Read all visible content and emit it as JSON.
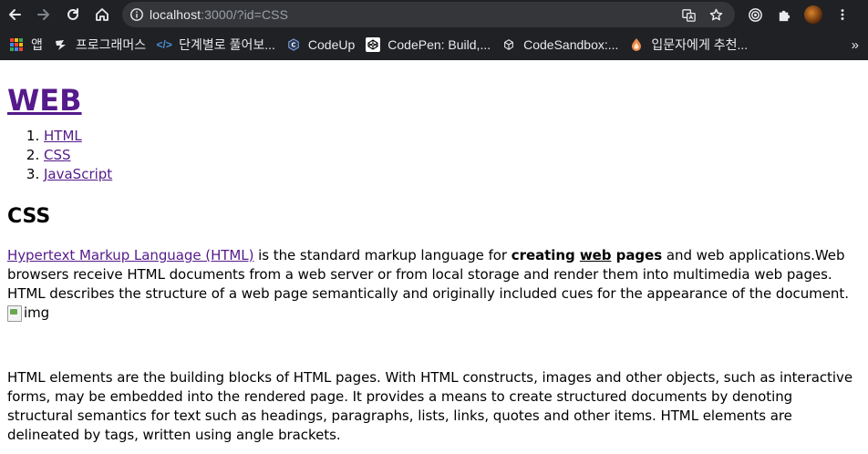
{
  "browser": {
    "url_host": "localhost",
    "url_rest": ":3000/?id=CSS",
    "bookmarks": [
      {
        "label": "앱",
        "icon": "apps-grid-icon"
      },
      {
        "label": "프로그래머스",
        "icon": "programmers-icon"
      },
      {
        "label": "단계별로 풀어보...",
        "icon": "code-brackets-icon"
      },
      {
        "label": "CodeUp",
        "icon": "codeup-icon"
      },
      {
        "label": "CodePen: Build,...",
        "icon": "codepen-icon"
      },
      {
        "label": "CodeSandbox:...",
        "icon": "codesandbox-icon"
      },
      {
        "label": "입문자에게 추천...",
        "icon": "inflearn-icon"
      }
    ],
    "more_bookmarks": "»"
  },
  "page": {
    "title": "WEB",
    "toc": [
      "HTML",
      "CSS",
      "JavaScript"
    ],
    "section_title": "CSS",
    "p1": {
      "link": "Hypertext Markup Language (HTML)",
      "t1": " is the standard markup language for ",
      "b1": "creating ",
      "bu": "web",
      "b2": " pages",
      "t2": " and web applications.Web browsers receive HTML documents from a web server or from local storage and render them into multimedia web pages. HTML describes the structure of a web page semantically and originally included cues for the appearance of the document. ",
      "img_alt": "img"
    },
    "p2": "HTML elements are the building blocks of HTML pages. With HTML constructs, images and other objects, such as interactive forms, may be embedded into the rendered page. It provides a means to create structured documents by denoting structural semantics for text such as headings, paragraphs, lists, links, quotes and other items. HTML elements are delineated by tags, written using angle brackets."
  }
}
